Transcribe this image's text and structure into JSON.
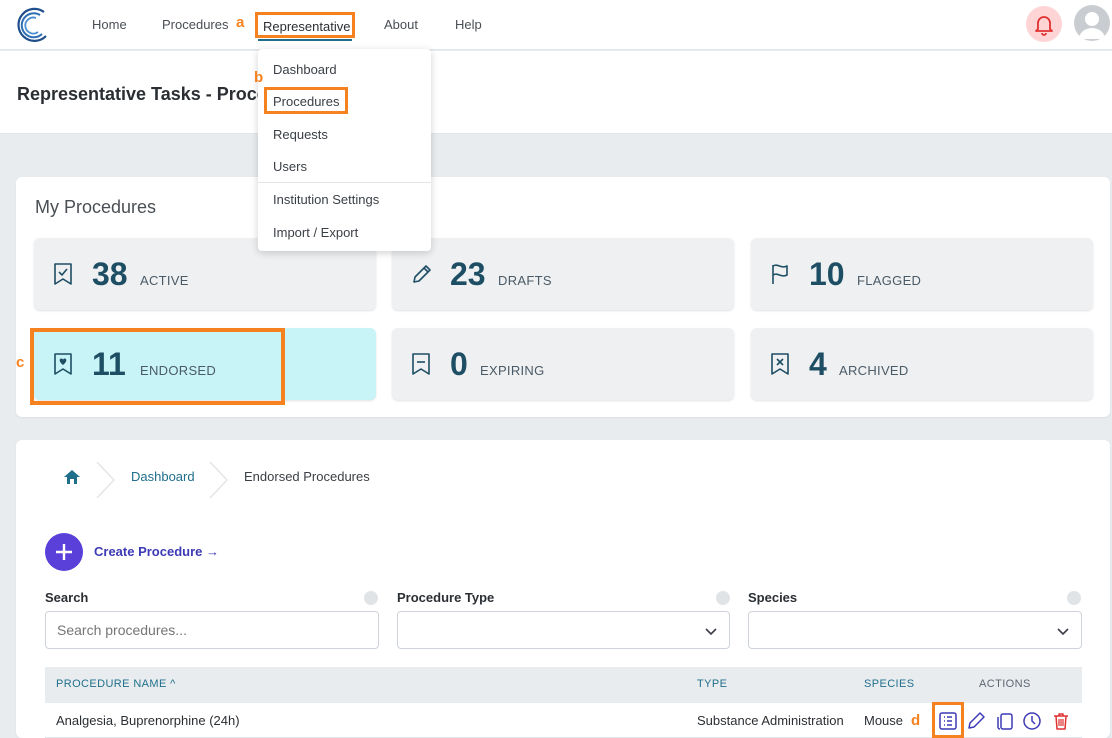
{
  "nav": {
    "items": [
      "Home",
      "Procedures",
      "Representative",
      "About",
      "Help"
    ],
    "active": "Representative"
  },
  "annotations": {
    "a": "a",
    "b": "b",
    "c": "c",
    "d": "d"
  },
  "page": {
    "title": "Representative Tasks - Proce"
  },
  "dropdown": {
    "items": [
      "Dashboard",
      "Procedures",
      "Requests",
      "Users",
      "Institution Settings",
      "Import / Export"
    ],
    "highlighted": "Procedures"
  },
  "my_procedures": {
    "heading": "My Procedures",
    "stats": [
      {
        "count": "38",
        "label": "ACTIVE",
        "icon": "bookmark-check-icon"
      },
      {
        "count": "23",
        "label": "DRAFTS",
        "icon": "pencil-icon"
      },
      {
        "count": "10",
        "label": "FLAGGED",
        "icon": "flag-icon"
      },
      {
        "count": "11",
        "label": "ENDORSED",
        "icon": "bookmark-heart-icon",
        "selected": true
      },
      {
        "count": "0",
        "label": "EXPIRING",
        "icon": "bookmark-dash-icon"
      },
      {
        "count": "4",
        "label": "ARCHIVED",
        "icon": "bookmark-x-icon"
      }
    ]
  },
  "breadcrumb": {
    "items": [
      "Dashboard",
      "Endorsed Procedures"
    ]
  },
  "create": {
    "label": "Create Procedure →"
  },
  "filters": {
    "search": {
      "label": "Search",
      "placeholder": "Search procedures..."
    },
    "type": {
      "label": "Procedure Type",
      "value": ""
    },
    "species": {
      "label": "Species",
      "value": ""
    }
  },
  "table": {
    "columns": [
      "PROCEDURE NAME ^",
      "TYPE",
      "SPECIES",
      "ACTIONS"
    ],
    "rows": [
      {
        "name": "Analgesia, Buprenorphine (24h)",
        "type": "Substance Administration",
        "species": "Mouse"
      }
    ]
  },
  "colors": {
    "accent": "#1f6f8b",
    "highlight": "#f5821f",
    "primary_button": "#5b3fd9",
    "selected_card": "#c9f4f7",
    "delete": "#e03131"
  }
}
